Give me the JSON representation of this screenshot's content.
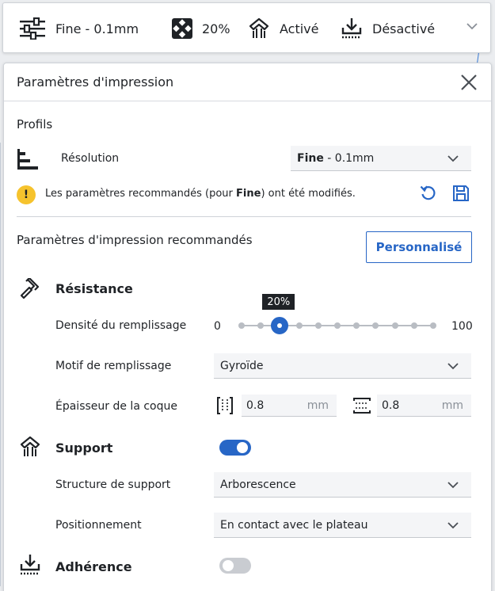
{
  "topbar": {
    "profile_label": "Fine - 0.1mm",
    "infill_label": "20%",
    "support_label": "Activé",
    "adhesion_label": "Désactivé"
  },
  "panel": {
    "title": "Paramètres d'impression",
    "profiles_heading": "Profils",
    "resolution_label": "Résolution",
    "resolution_value_bold": "Fine",
    "resolution_value_rest": " - 0.1mm",
    "warning": {
      "prefix": "Les paramètres recommandés (pour ",
      "bold": "Fine",
      "suffix": ") ont été modifiés."
    },
    "recommended_heading": "Paramètres d'impression recommandés",
    "custom_button": "Personnalisé"
  },
  "strength": {
    "heading": "Résistance",
    "infill_density_label": "Densité du remplissage",
    "slider_min": "0",
    "slider_max": "100",
    "slider_value_label": "20%",
    "slider_value": 20,
    "infill_pattern_label": "Motif de remplissage",
    "infill_pattern_value": "Gyroïde",
    "shell_thickness_label": "Épaisseur de la coque",
    "wall_thickness": "0.8",
    "top_bottom_thickness": "0.8",
    "unit": "mm"
  },
  "support": {
    "heading": "Support",
    "enabled": true,
    "structure_label": "Structure de support",
    "structure_value": "Arborescence",
    "placement_label": "Positionnement",
    "placement_value": "En contact avec le plateau"
  },
  "adhesion": {
    "heading": "Adhérence",
    "enabled": false
  },
  "colors": {
    "accent": "#2766c6",
    "warning": "#f6c32d",
    "text": "#1f2226"
  }
}
